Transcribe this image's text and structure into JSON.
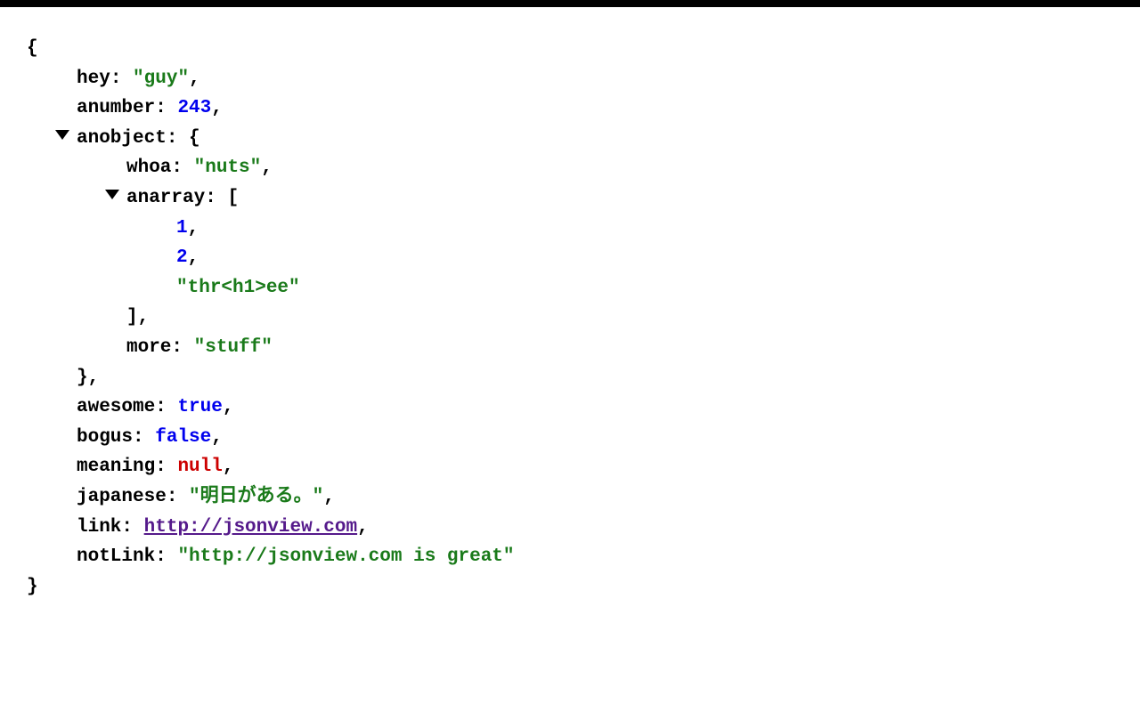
{
  "json": {
    "open_brace": "{",
    "close_brace": "}",
    "open_bracket": "[",
    "close_bracket": "]",
    "comma": ",",
    "colon": ":",
    "quote": "\"",
    "space": " "
  },
  "root": {
    "hey": {
      "key": "hey",
      "value": "guy"
    },
    "anumber": {
      "key": "anumber",
      "value": "243"
    },
    "anobject": {
      "key": "anobject",
      "whoa": {
        "key": "whoa",
        "value": "nuts"
      },
      "anarray": {
        "key": "anarray",
        "items": {
          "0": "1",
          "1": "2",
          "2": "thr<h1>ee"
        }
      },
      "more": {
        "key": "more",
        "value": "stuff"
      }
    },
    "awesome": {
      "key": "awesome",
      "value": "true"
    },
    "bogus": {
      "key": "bogus",
      "value": "false"
    },
    "meaning": {
      "key": "meaning",
      "value": "null"
    },
    "japanese": {
      "key": "japanese",
      "value": "明日がある。"
    },
    "link": {
      "key": "link",
      "value": "http://jsonview.com"
    },
    "notLink": {
      "key": "notLink",
      "value": "http://jsonview.com is great"
    }
  }
}
